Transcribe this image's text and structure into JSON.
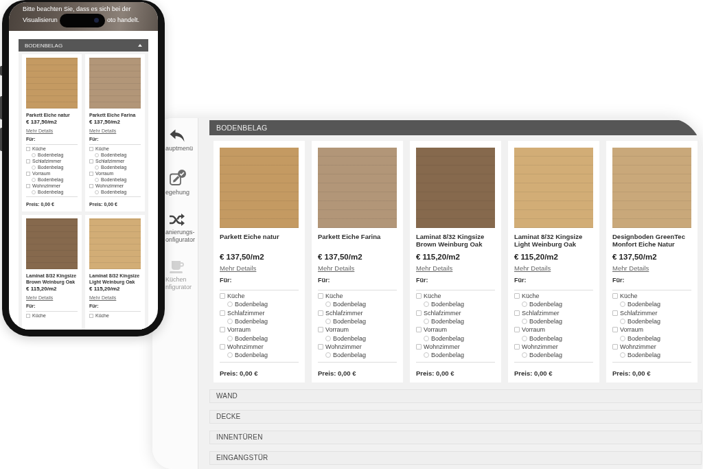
{
  "phone": {
    "notice": {
      "first_line": "Bitte beachten Sie, dass es sich bei der",
      "second_line_start": "Visualisierun",
      "second_line_end": "oto handelt."
    },
    "sections": [
      {
        "title": "BODENBELAG",
        "expanded": true,
        "cards": [
          {
            "name": "Parkett Eiche natur",
            "price": "€ 137,50/m2",
            "details_link": "Mehr Details",
            "for_label": "Für:",
            "color": "#c49a62",
            "rooms": [
              {
                "name": "Küche",
                "checked": false,
                "options": [
                  {
                    "label": "Bodenbelag",
                    "selected": false
                  }
                ]
              },
              {
                "name": "Schlafzimmer",
                "checked": false,
                "options": [
                  {
                    "label": "Bodenbelag",
                    "selected": false
                  }
                ]
              },
              {
                "name": "Vorraum",
                "checked": false,
                "options": [
                  {
                    "label": "Bodenbelag",
                    "selected": false
                  }
                ]
              },
              {
                "name": "Wohnzimmer",
                "checked": false,
                "options": [
                  {
                    "label": "Bodenbelag",
                    "selected": false
                  }
                ]
              }
            ],
            "total": "Preis: 0,00 €"
          },
          {
            "name": "Parkett Eiche Farina",
            "price": "€ 137,50/m2",
            "details_link": "Mehr Details",
            "for_label": "Für:",
            "color": "#b29678",
            "rooms": [
              {
                "name": "Küche",
                "checked": false,
                "options": [
                  {
                    "label": "Bodenbelag",
                    "selected": false
                  }
                ]
              },
              {
                "name": "Schlafzimmer",
                "checked": false,
                "options": [
                  {
                    "label": "Bodenbelag",
                    "selected": false
                  }
                ]
              },
              {
                "name": "Vorraum",
                "checked": false,
                "options": [
                  {
                    "label": "Bodenbelag",
                    "selected": false
                  }
                ]
              },
              {
                "name": "Wohnzimmer",
                "checked": false,
                "options": [
                  {
                    "label": "Bodenbelag",
                    "selected": false
                  }
                ]
              }
            ],
            "total": "Preis: 0,00 €"
          },
          {
            "name": "Laminat 8/32 Kingsize Brown Weinburg Oak",
            "price": "€ 115,20/m2",
            "details_link": "Mehr Details",
            "for_label": "Für:",
            "color": "#86694d",
            "rooms": [
              {
                "name": "Küche",
                "checked": false
              }
            ]
          },
          {
            "name": "Laminat 8/32 Kingsize Light Weinburg Oak",
            "price": "€ 115,20/m2",
            "details_link": "Mehr Details",
            "for_label": "Für:",
            "color": "#d2ad76",
            "rooms": [
              {
                "name": "Küche",
                "checked": false
              }
            ]
          }
        ]
      }
    ]
  },
  "tablet": {
    "sidebar": [
      {
        "label_lines": [
          "auptmenü"
        ],
        "disabled": false
      },
      {
        "label_lines": [
          "egehung"
        ],
        "disabled": false
      },
      {
        "label_lines": [
          "anierungs-",
          "onfigurator"
        ],
        "disabled": false
      },
      {
        "label_lines": [
          "Küchen",
          "nfigurator"
        ],
        "disabled": true
      }
    ],
    "sections": [
      {
        "title": "BODENBELAG",
        "expanded": true,
        "cards": [
          {
            "name": "Parkett Eiche natur",
            "price": "€ 137,50/m2",
            "details_link": "Mehr Details",
            "for_label": "Für:",
            "color": "#c49a62",
            "rooms": [
              {
                "name": "Küche",
                "checked": false,
                "options": [
                  {
                    "label": "Bodenbelag",
                    "selected": false
                  }
                ]
              },
              {
                "name": "Schlafzimmer",
                "checked": false,
                "options": [
                  {
                    "label": "Bodenbelag",
                    "selected": false
                  }
                ]
              },
              {
                "name": "Vorraum",
                "checked": false,
                "options": [
                  {
                    "label": "Bodenbelag",
                    "selected": false
                  }
                ]
              },
              {
                "name": "Wohnzimmer",
                "checked": false,
                "options": [
                  {
                    "label": "Bodenbelag",
                    "selected": false
                  }
                ]
              }
            ],
            "total": "Preis: 0,00 €"
          },
          {
            "name": "Parkett Eiche Farina",
            "price": "€ 137,50/m2",
            "details_link": "Mehr Details",
            "for_label": "Für:",
            "color": "#b29678",
            "rooms": [
              {
                "name": "Küche",
                "checked": false,
                "options": [
                  {
                    "label": "Bodenbelag",
                    "selected": false
                  }
                ]
              },
              {
                "name": "Schlafzimmer",
                "checked": false,
                "options": [
                  {
                    "label": "Bodenbelag",
                    "selected": false
                  }
                ]
              },
              {
                "name": "Vorraum",
                "checked": false,
                "options": [
                  {
                    "label": "Bodenbelag",
                    "selected": false
                  }
                ]
              },
              {
                "name": "Wohnzimmer",
                "checked": false,
                "options": [
                  {
                    "label": "Bodenbelag",
                    "selected": false
                  }
                ]
              }
            ],
            "total": "Preis: 0,00 €"
          },
          {
            "name": "Laminat 8/32 Kingsize Brown Weinburg Oak",
            "price": "€ 115,20/m2",
            "details_link": "Mehr Details",
            "for_label": "Für:",
            "color": "#86694d",
            "rooms": [
              {
                "name": "Küche",
                "checked": false,
                "options": [
                  {
                    "label": "Bodenbelag",
                    "selected": false
                  }
                ]
              },
              {
                "name": "Schlafzimmer",
                "checked": false,
                "options": [
                  {
                    "label": "Bodenbelag",
                    "selected": false
                  }
                ]
              },
              {
                "name": "Vorraum",
                "checked": false,
                "options": [
                  {
                    "label": "Bodenbelag",
                    "selected": false
                  }
                ]
              },
              {
                "name": "Wohnzimmer",
                "checked": false,
                "options": [
                  {
                    "label": "Bodenbelag",
                    "selected": false
                  }
                ]
              }
            ],
            "total": "Preis: 0,00 €"
          },
          {
            "name": "Laminat 8/32 Kingsize Light Weinburg Oak",
            "price": "€ 115,20/m2",
            "details_link": "Mehr Details",
            "for_label": "Für:",
            "color": "#d2ad76",
            "rooms": [
              {
                "name": "Küche",
                "checked": false,
                "options": [
                  {
                    "label": "Bodenbelag",
                    "selected": false
                  }
                ]
              },
              {
                "name": "Schlafzimmer",
                "checked": false,
                "options": [
                  {
                    "label": "Bodenbelag",
                    "selected": false
                  }
                ]
              },
              {
                "name": "Vorraum",
                "checked": false,
                "options": [
                  {
                    "label": "Bodenbelag",
                    "selected": false
                  }
                ]
              },
              {
                "name": "Wohnzimmer",
                "checked": false,
                "options": [
                  {
                    "label": "Bodenbelag",
                    "selected": false
                  }
                ]
              }
            ],
            "total": "Preis: 0,00 €"
          },
          {
            "name": "Designboden GreenTec Monfort Eiche Natur",
            "price": "€ 137,50/m2",
            "details_link": "Mehr Details",
            "for_label": "Für:",
            "color": "#c9a87a",
            "rooms": [
              {
                "name": "Küche",
                "checked": false,
                "options": [
                  {
                    "label": "Bodenbelag",
                    "selected": false
                  }
                ]
              },
              {
                "name": "Schlafzimmer",
                "checked": false,
                "options": [
                  {
                    "label": "Bodenbelag",
                    "selected": false
                  }
                ]
              },
              {
                "name": "Vorraum",
                "checked": false,
                "options": [
                  {
                    "label": "Bodenbelag",
                    "selected": false
                  }
                ]
              },
              {
                "name": "Wohnzimmer",
                "checked": false,
                "options": [
                  {
                    "label": "Bodenbelag",
                    "selected": false
                  }
                ]
              }
            ],
            "total": "Preis: 0,00 €"
          }
        ]
      },
      {
        "title": "WAND",
        "expanded": false
      },
      {
        "title": "DECKE",
        "expanded": false
      },
      {
        "title": "INNENTÜREN",
        "expanded": false
      },
      {
        "title": "EINGANGSTÜR",
        "expanded": false
      }
    ]
  }
}
